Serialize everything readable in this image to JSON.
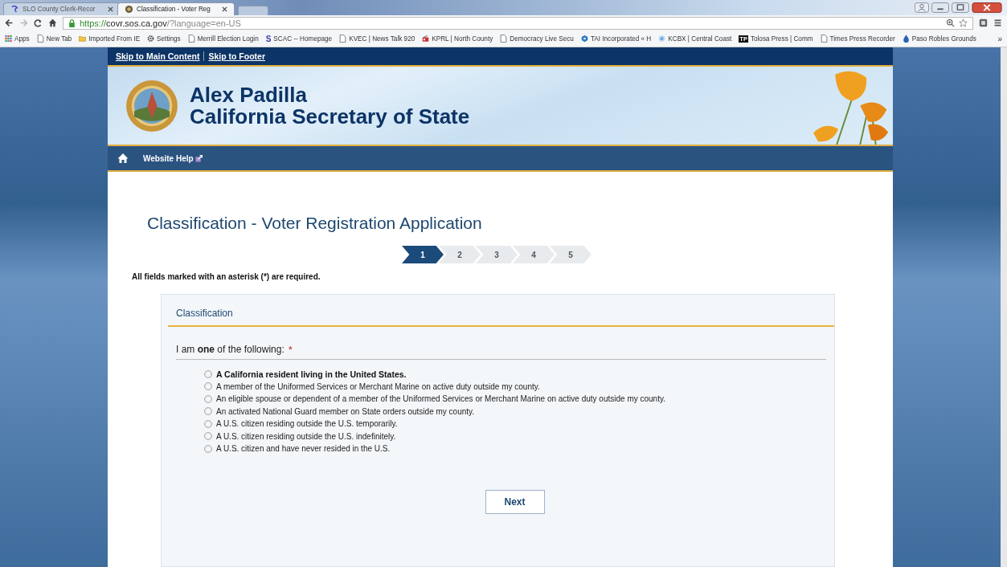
{
  "browser": {
    "tabs": [
      {
        "label": "SLO County Clerk-Recor",
        "selected": false,
        "kind": "slo"
      },
      {
        "label": "Classification - Voter Reg",
        "selected": true,
        "kind": "globe"
      }
    ],
    "url": {
      "scheme": "https://",
      "host": "covr.sos.ca.gov",
      "path": "/?language=en-US"
    },
    "bookmarks": [
      {
        "label": "Apps",
        "kind": "apps"
      },
      {
        "label": "New Tab",
        "kind": "page"
      },
      {
        "label": "Imported From IE",
        "kind": "folder"
      },
      {
        "label": "Settings",
        "kind": "gear"
      },
      {
        "label": "Merrill Election Login",
        "kind": "page"
      },
      {
        "label": "SCAC -- Homepage",
        "kind": "letter",
        "badge": "S"
      },
      {
        "label": "KVEC | News Talk 920",
        "kind": "page"
      },
      {
        "label": "KPRL | North County",
        "kind": "radio"
      },
      {
        "label": "Democracy Live Secu",
        "kind": "page"
      },
      {
        "label": "TAI Incorporated « H",
        "kind": "hex"
      },
      {
        "label": "KCBX | Central Coast",
        "kind": "dot"
      },
      {
        "label": "Tolosa Press | Comm",
        "kind": "tile",
        "badge": "TP"
      },
      {
        "label": "Times Press Recorder",
        "kind": "page"
      },
      {
        "label": "Paso Robles Grounds",
        "kind": "drop"
      }
    ],
    "more": "»"
  },
  "skip_links": [
    "Skip to Main Content",
    "Skip to Footer"
  ],
  "header": {
    "name": "Alex Padilla",
    "office": "California Secretary of State"
  },
  "nav": {
    "help": "Website Help"
  },
  "page": {
    "title": "Classification - Voter Registration Application",
    "steps": [
      {
        "label": "1",
        "selected": true
      },
      {
        "label": "2",
        "selected": false
      },
      {
        "label": "3",
        "selected": false
      },
      {
        "label": "4",
        "selected": false
      },
      {
        "label": "5",
        "selected": false
      }
    ],
    "required_note": "All fields marked with an asterisk (*) are required.",
    "section": {
      "title": "Classification",
      "question": "I am **one** of the following:",
      "required_mark": "*",
      "options": [
        {
          "label": "A California resident living in the United States.",
          "selected": false,
          "emphasized": true
        },
        {
          "label": "A member of the Uniformed Services or Merchant Marine on active duty outside my county.",
          "selected": false,
          "emphasized": false
        },
        {
          "label": "An eligible spouse or dependent of a member of the Uniformed Services or Merchant Marine on active duty outside my county.",
          "selected": false,
          "emphasized": false
        },
        {
          "label": "An activated National Guard member on State orders outside my county.",
          "selected": false,
          "emphasized": false
        },
        {
          "label": "A U.S. citizen residing outside the U.S. temporarily.",
          "selected": false,
          "emphasized": false
        },
        {
          "label": "A U.S. citizen residing outside the U.S. indefinitely.",
          "selected": false,
          "emphasized": false
        },
        {
          "label": "A U.S. citizen and have never resided in the U.S.",
          "selected": false,
          "emphasized": false
        }
      ],
      "next": "Next"
    }
  }
}
